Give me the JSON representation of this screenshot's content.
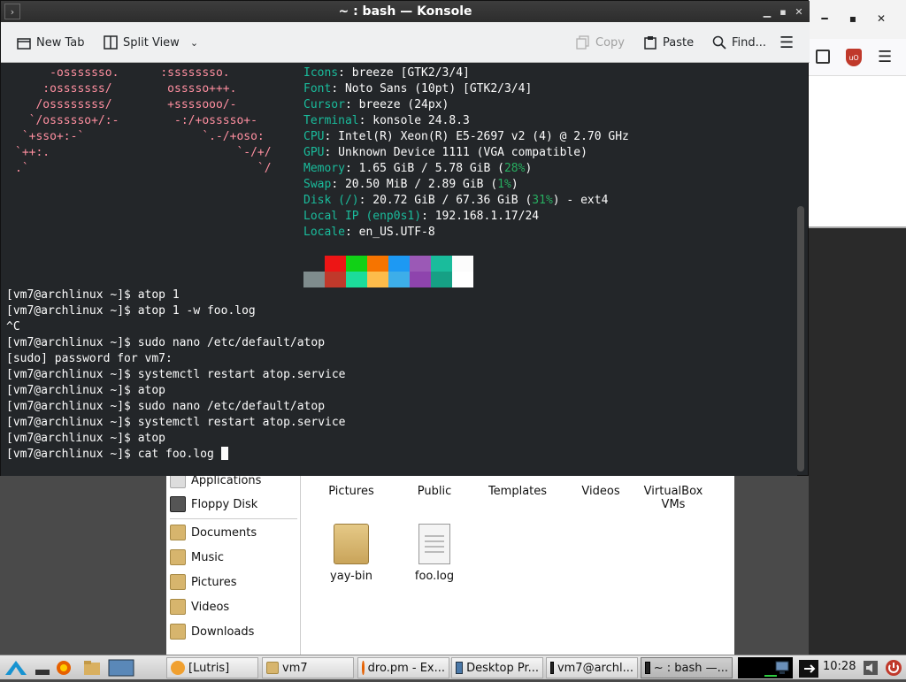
{
  "konsole": {
    "title": "~ : bash — Konsole",
    "toolbar": {
      "new_tab": "New Tab",
      "split_view": "Split View",
      "copy": "Copy",
      "paste": "Paste",
      "find": "Find..."
    },
    "logo_lines": [
      "     -osssssso.      :ssssssso.",
      "    :osssssss/        osssso+++.",
      "   /ossssssss/        +ssssooo/-",
      "  `/ossssso+/:-        -:/+osssso+-",
      " `+sso+:-`                 `.-/+oso:",
      "`++:.                           `-/+/",
      ".`                                 `/"
    ],
    "info": [
      {
        "key": "Icons",
        "value": ": breeze [GTK2/3/4]"
      },
      {
        "key": "Font",
        "value": ": Noto Sans (10pt) [GTK2/3/4]"
      },
      {
        "key": "Cursor",
        "value": ": breeze (24px)"
      },
      {
        "key": "Terminal",
        "value": ": konsole 24.8.3"
      },
      {
        "key": "CPU",
        "value": ": Intel(R) Xeon(R) E5-2697 v2 (4) @ 2.70 GHz"
      },
      {
        "key": "GPU",
        "value": ": Unknown Device 1111 (VGA compatible)"
      },
      {
        "key": "Memory",
        "value": ": 1.65 GiB / 5.78 GiB (",
        "pct": "28%",
        "tail": ")"
      },
      {
        "key": "Swap",
        "value": ": 20.50 MiB / 2.89 GiB (",
        "pct": "1%",
        "tail": ")"
      },
      {
        "key": "Disk (/)",
        "value": ": 20.72 GiB / 67.36 GiB (",
        "pct": "31%",
        "tail": ") - ext4"
      },
      {
        "key": "Local IP (enp0s1)",
        "value": ": 192.168.1.17/24"
      },
      {
        "key": "Locale",
        "value": ": en_US.UTF-8"
      }
    ],
    "swatches_top": [
      "#232629",
      "#ed1515",
      "#11d116",
      "#f67400",
      "#1d99f3",
      "#9b59b6",
      "#1abc9c",
      "#fcfcfc"
    ],
    "swatches_bottom": [
      "#7f8c8d",
      "#c0392b",
      "#1cdc9a",
      "#fdbc4b",
      "#3daee9",
      "#8e44ad",
      "#16a085",
      "#ffffff"
    ],
    "history": [
      "[vm7@archlinux ~]$ atop 1",
      "[vm7@archlinux ~]$ atop 1 -w foo.log",
      "^C",
      "[vm7@archlinux ~]$ sudo nano /etc/default/atop",
      "[sudo] password for vm7:",
      "[vm7@archlinux ~]$ systemctl restart atop.service",
      "[vm7@archlinux ~]$ atop",
      "[vm7@archlinux ~]$ sudo nano /etc/default/atop",
      "[vm7@archlinux ~]$ systemctl restart atop.service",
      "[vm7@archlinux ~]$ atop",
      "[vm7@archlinux ~]$ cat foo.log "
    ]
  },
  "file_manager": {
    "sidebar": [
      "Applications",
      "Floppy Disk",
      "Documents",
      "Music",
      "Pictures",
      "Videos",
      "Downloads"
    ],
    "items_row1": [
      "Pictures",
      "Public",
      "Templates",
      "Videos",
      "VirtualBox VMs"
    ],
    "items_row2": [
      "yay-bin",
      "foo.log"
    ]
  },
  "taskbar": {
    "tasks": [
      "[Lutris]",
      "vm7",
      "dro.pm - Ex...",
      "Desktop Pr...",
      "vm7@archl...",
      "~ : bash —..."
    ],
    "clock": "10:28"
  }
}
